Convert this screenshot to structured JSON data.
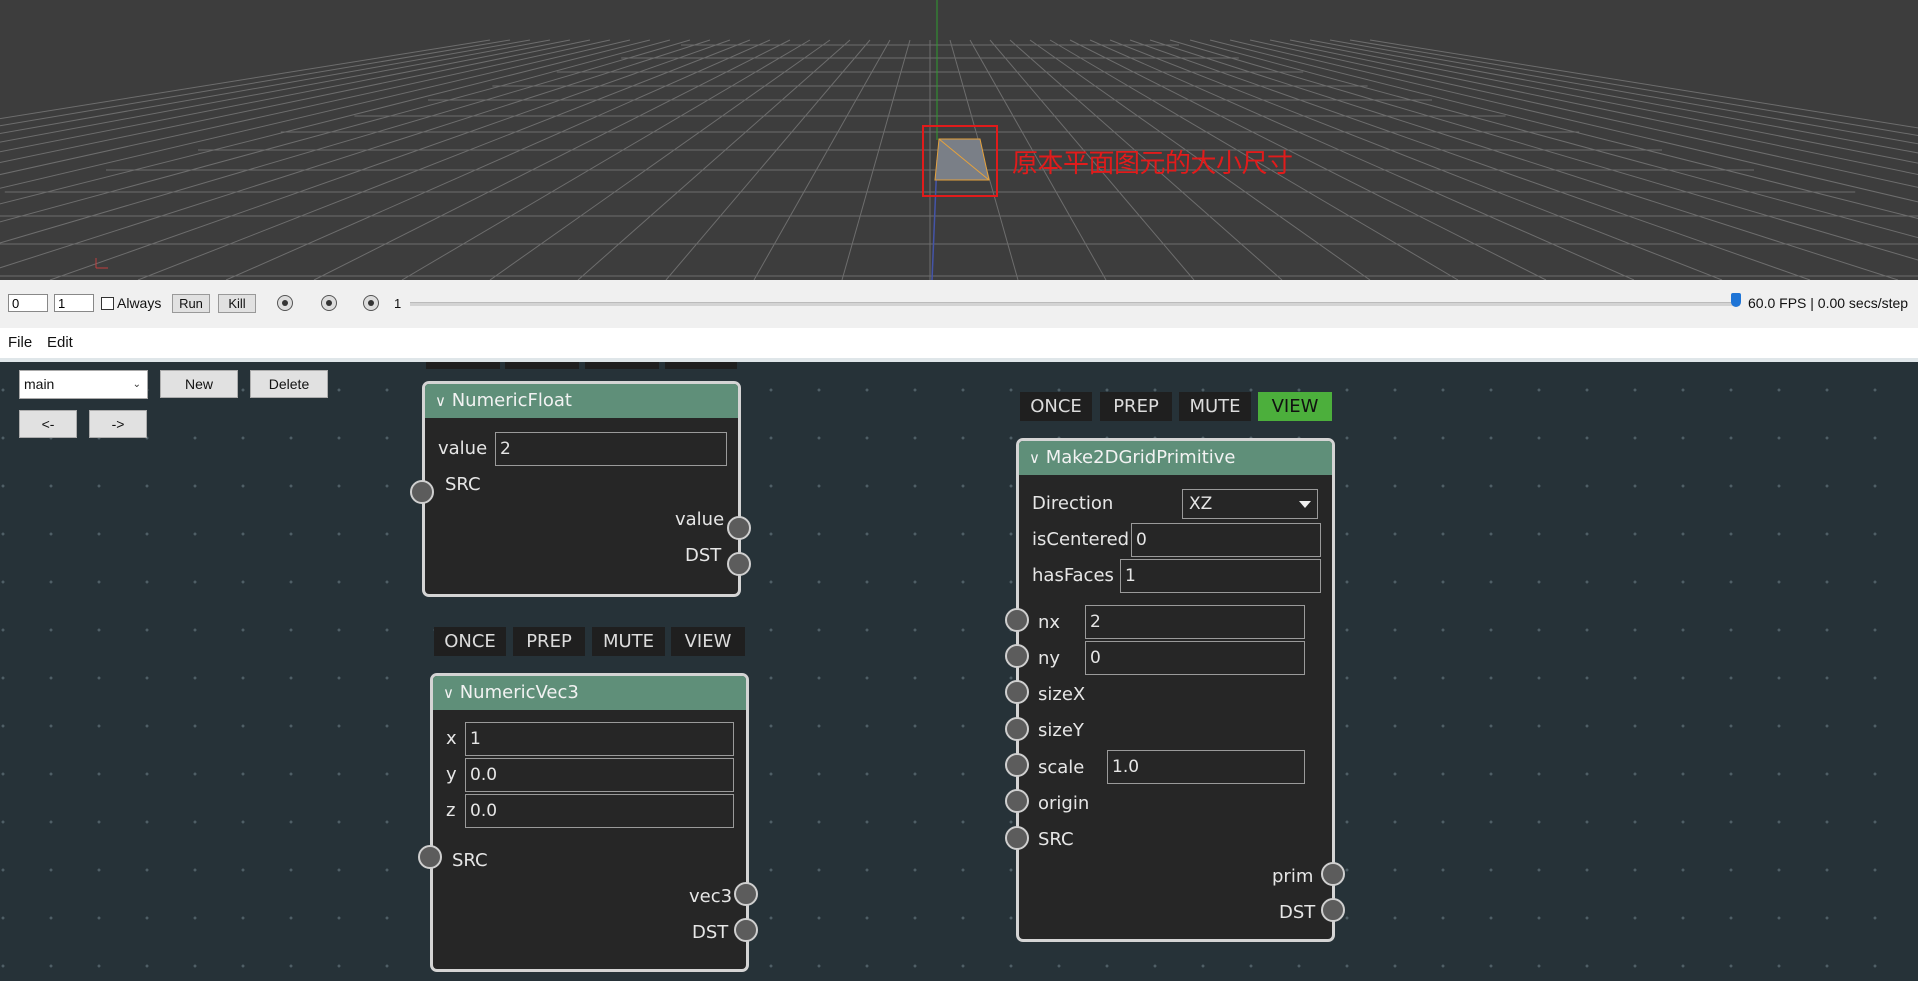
{
  "viewport": {
    "annotation": "原本平面图元的大小尺寸"
  },
  "timeline": {
    "start_frame": "0",
    "end_frame": "1",
    "always_label": "Always",
    "run_label": "Run",
    "kill_label": "Kill",
    "current_frame": "1",
    "status": "60.0 FPS | 0.00 secs/step"
  },
  "menu": {
    "file": "File",
    "edit": "Edit"
  },
  "graph": {
    "selected": "main",
    "new_label": "New",
    "delete_label": "Delete",
    "prev_label": "<-",
    "next_label": "->"
  },
  "nodes": {
    "numeric_float": {
      "title": "NumericFloat",
      "value_label": "value",
      "value": "2",
      "src": "SRC",
      "out_value": "value",
      "dst": "DST"
    },
    "numeric_vec3": {
      "title": "NumericVec3",
      "buttons": [
        "ONCE",
        "PREP",
        "MUTE",
        "VIEW"
      ],
      "x_label": "x",
      "x": "1",
      "y_label": "y",
      "y": "0.0",
      "z_label": "z",
      "z": "0.0",
      "src": "SRC",
      "out_vec3": "vec3",
      "dst": "DST"
    },
    "grid": {
      "title": "Make2DGridPrimitive",
      "buttons": [
        "ONCE",
        "PREP",
        "MUTE",
        "VIEW"
      ],
      "view_active_color": "#4caf3c",
      "direction_label": "Direction",
      "direction": "XZ",
      "iscentered_label": "isCentered",
      "iscentered": "0",
      "hasfaces_label": "hasFaces",
      "hasfaces": "1",
      "nx_label": "nx",
      "nx": "2",
      "ny_label": "ny",
      "ny": "0",
      "sizex_label": "sizeX",
      "sizey_label": "sizeY",
      "scale_label": "scale",
      "scale": "1.0",
      "origin_label": "origin",
      "src": "SRC",
      "out_prim": "prim",
      "dst": "DST"
    }
  }
}
